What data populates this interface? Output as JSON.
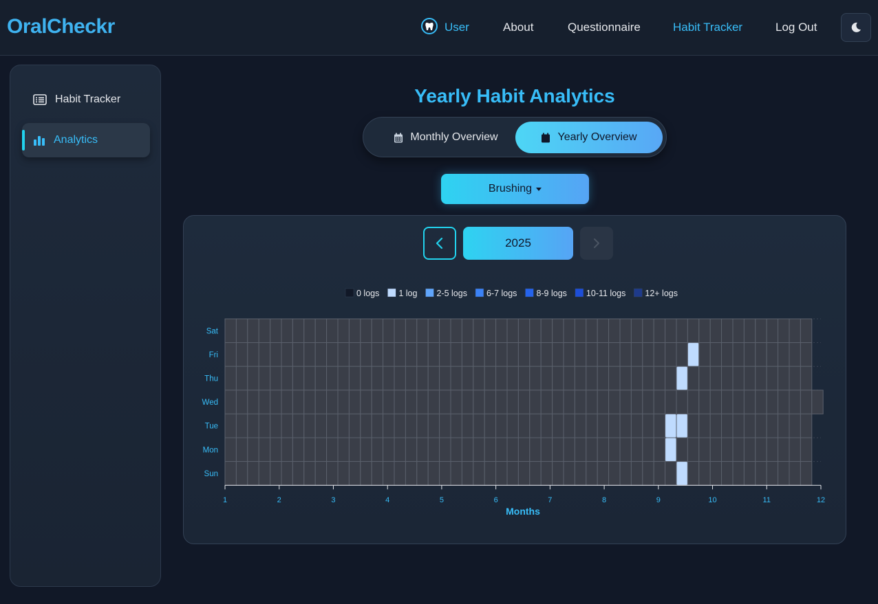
{
  "nav": {
    "brand": "OralCheckr",
    "user": "User",
    "about": "About",
    "questionnaire": "Questionnaire",
    "habit_tracker": "Habit Tracker",
    "logout": "Log Out",
    "user_icon": "tooth-icon",
    "theme_icon": "moon-icon"
  },
  "sidebar": {
    "items": [
      {
        "label": "Habit Tracker",
        "icon": "list-icon",
        "active": false
      },
      {
        "label": "Analytics",
        "icon": "bar-chart-icon",
        "active": true
      }
    ]
  },
  "main": {
    "title": "Yearly Habit Analytics",
    "tabs": [
      {
        "label": "Monthly Overview",
        "icon": "calendar-icon",
        "active": false
      },
      {
        "label": "Yearly Overview",
        "icon": "calendar-icon",
        "active": true
      }
    ],
    "habit_select": "Brushing",
    "year": "2025"
  },
  "colors": {
    "accent": "#38bdf8",
    "cell_empty": "#3a3e48",
    "cell_1": "#bfdbfe"
  },
  "chart_data": {
    "type": "heatmap",
    "xlabel": "Months",
    "x_ticks": [
      "1",
      "2",
      "3",
      "4",
      "5",
      "6",
      "7",
      "8",
      "9",
      "10",
      "11",
      "12"
    ],
    "y_ticks": [
      "Sun",
      "Mon",
      "Tue",
      "Wed",
      "Thu",
      "Fri",
      "Sat"
    ],
    "legend": [
      {
        "label": "0 logs",
        "color": "#111827"
      },
      {
        "label": "1 log",
        "color": "#bfdbfe"
      },
      {
        "label": "2-5 logs",
        "color": "#60a5fa"
      },
      {
        "label": "6-7 logs",
        "color": "#3b82f6"
      },
      {
        "label": "8-9 logs",
        "color": "#2563eb"
      },
      {
        "label": "10-11 logs",
        "color": "#1d4ed8"
      },
      {
        "label": "12+ logs",
        "color": "#1e3a8a"
      }
    ],
    "weeks": 53,
    "logged_cells": [
      {
        "week": 39,
        "day": "Mon",
        "logs": 1
      },
      {
        "week": 39,
        "day": "Tue",
        "logs": 1
      },
      {
        "week": 40,
        "day": "Sun",
        "logs": 1
      },
      {
        "week": 40,
        "day": "Tue",
        "logs": 1
      },
      {
        "week": 40,
        "day": "Thu",
        "logs": 1
      },
      {
        "week": 41,
        "day": "Fri",
        "logs": 1
      }
    ]
  }
}
